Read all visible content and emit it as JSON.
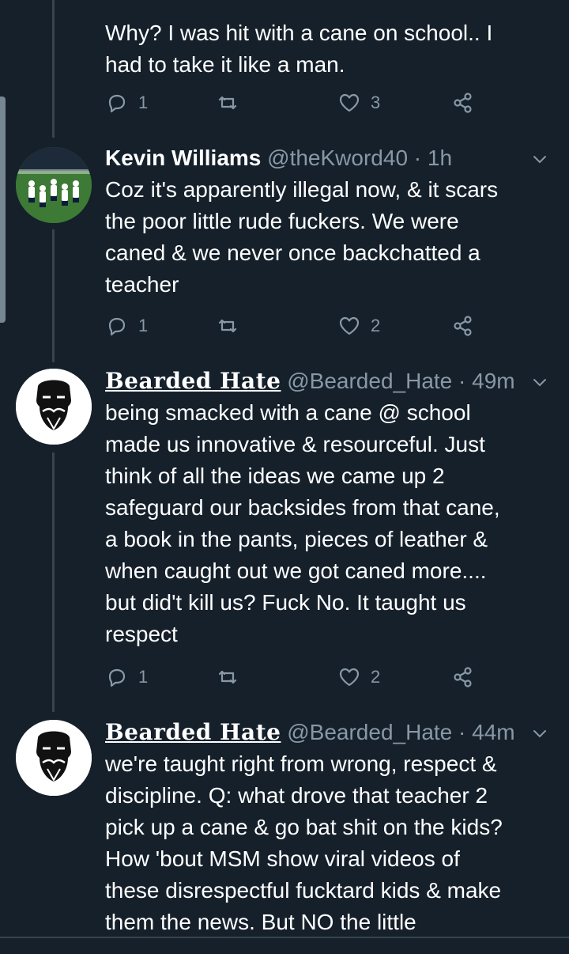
{
  "tweets": [
    {
      "text": "Why? I was hit with a cane on school.. I\nhad to take it like a man.",
      "replies": "1",
      "retweets": "",
      "likes": "3"
    },
    {
      "name": "Kevin Williams",
      "handle": "@theKword40",
      "time": "· 1h",
      "text": "Coz it's apparently illegal now, & it scars\nthe poor little rude fuckers. We were\ncaned & we never once backchatted a\nteacher",
      "replies": "1",
      "retweets": "",
      "likes": "2"
    },
    {
      "name": "Bearded Hate",
      "handle": "@Bearded_Hate",
      "time": "· 49m",
      "text": "being smacked with a cane @ school\nmade us innovative & resourceful. Just\nthink of all the ideas we came up 2\nsafeguard our backsides from that cane,\na book in the pants, pieces of leather &\nwhen caught out we got caned more....\nbut did't kill us?  Fuck No. It taught us\nrespect",
      "replies": "1",
      "retweets": "",
      "likes": "2"
    },
    {
      "name": "Bearded Hate",
      "handle": "@Bearded_Hate",
      "time": "· 44m",
      "text": "we're taught right from wrong, respect &\ndiscipline. Q: what drove that teacher 2\npick up a cane & go bat shit on the kids?\nHow 'bout MSM show viral videos of\nthese disrespectful fucktard kids & make\nthem the news. But NO the little"
    }
  ],
  "icons": {
    "reply": "reply-icon",
    "retweet": "retweet-icon",
    "like": "heart-icon",
    "share": "share-icon",
    "caret": "chevron-down-icon"
  },
  "colors": {
    "background": "#15202b",
    "secondary_text": "#8899a6",
    "line": "#38444d"
  }
}
